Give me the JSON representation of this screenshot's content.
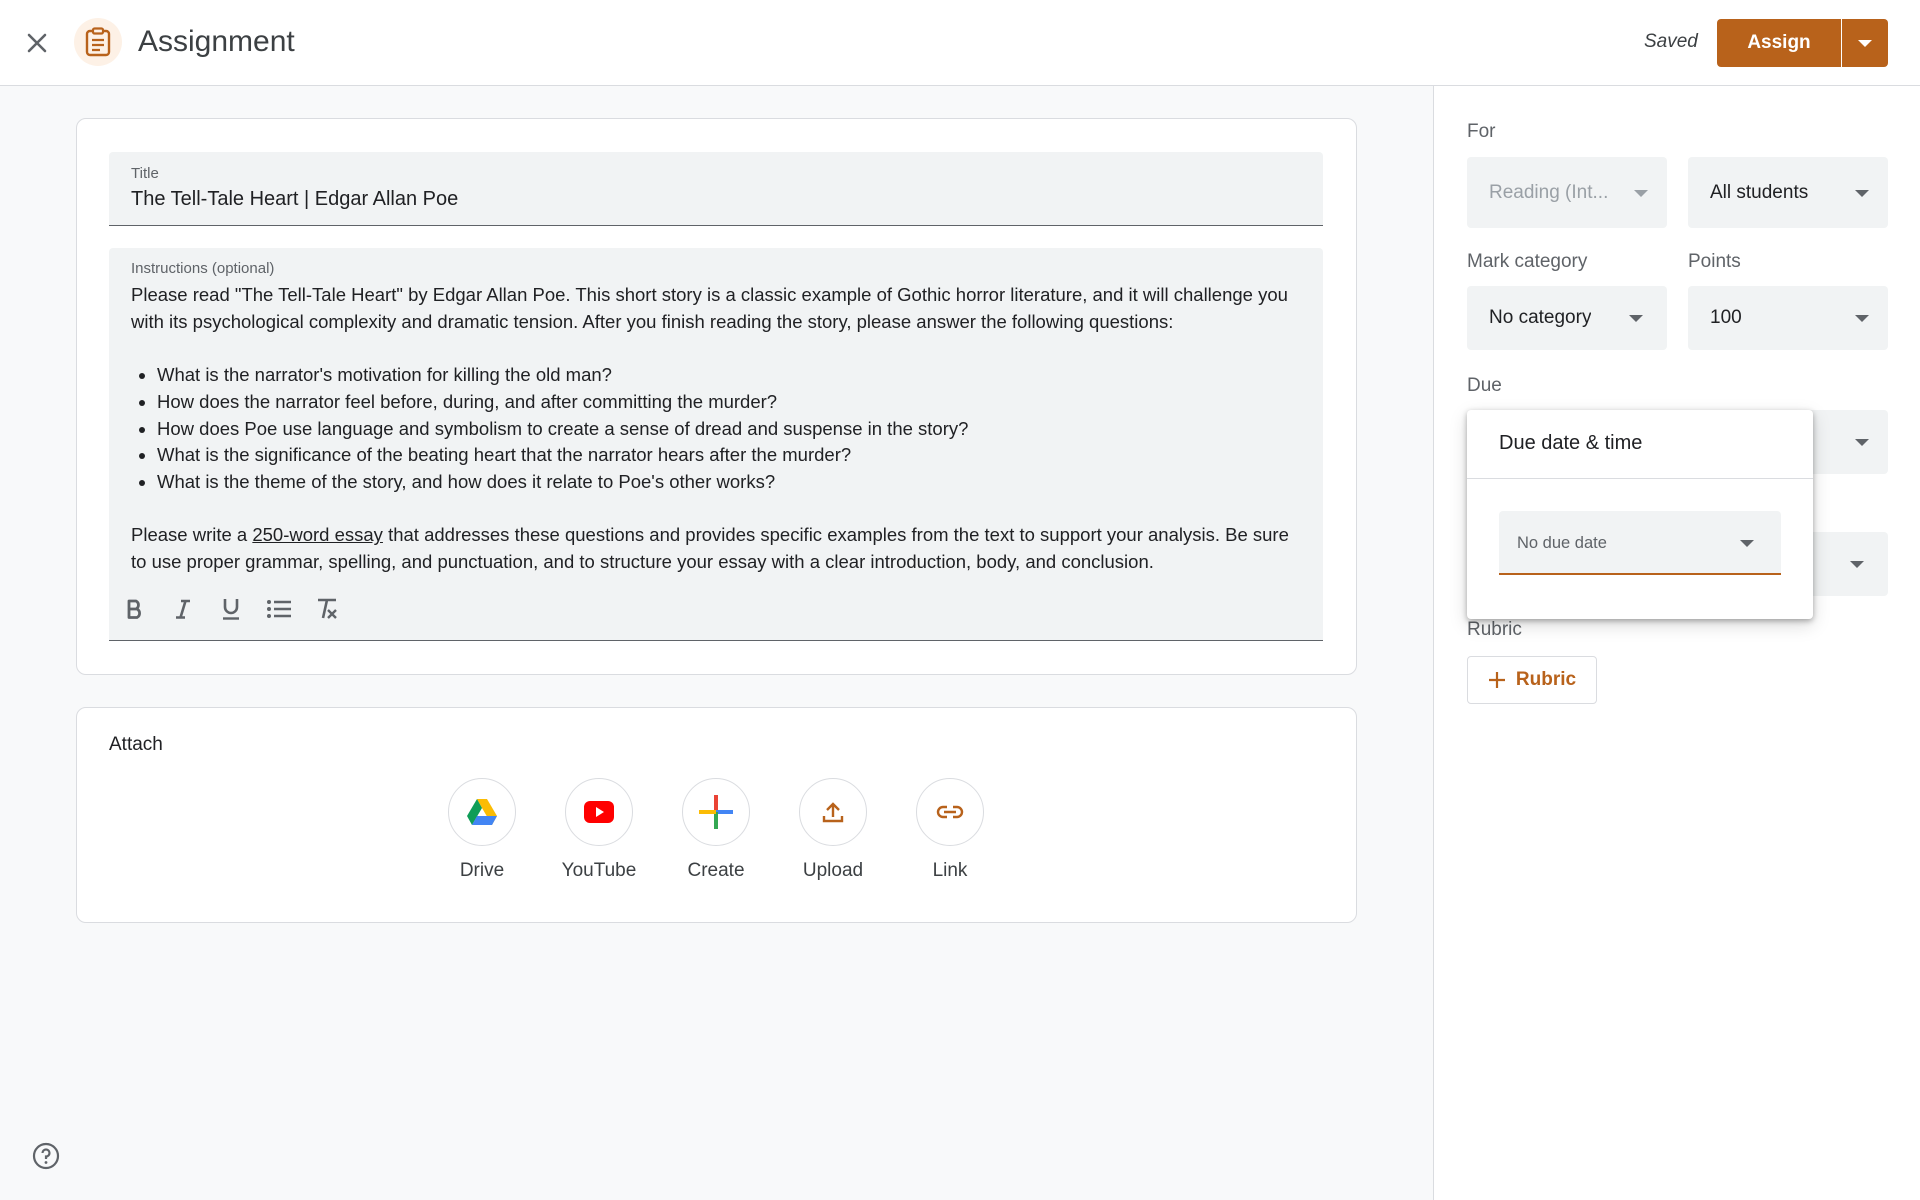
{
  "header": {
    "title": "Assignment",
    "status": "Saved",
    "assign_label": "Assign"
  },
  "main": {
    "title_label": "Title",
    "title_value": "The Tell-Tale Heart | Edgar Allan Poe",
    "instructions_label": "Instructions (optional)",
    "intro": "Please read \"The Tell-Tale Heart\" by Edgar Allan Poe. This short story is a classic example of Gothic horror literature, and it will challenge you with its psychological complexity and dramatic tension. After you finish reading the story, please answer the following questions:",
    "questions": [
      "What is the narrator's motivation for killing the old man?",
      "How does the narrator feel before, during, and after committing the murder?",
      "How does Poe use language and symbolism to create a sense of dread and suspense in the story?",
      "What is the significance of the beating heart that the narrator hears after the murder?",
      "What is the theme of the story, and how does it relate to Poe's other works?"
    ],
    "closing_before": "Please write a ",
    "closing_link": "250-word essay",
    "closing_after": " that addresses these questions and provides specific examples from the text to support your analysis. Be sure to use proper grammar, spelling, and punctuation, and to structure your essay with a clear introduction, body, and conclusion."
  },
  "attach": {
    "label": "Attach",
    "items": [
      {
        "label": "Drive",
        "icon": "drive-icon"
      },
      {
        "label": "YouTube",
        "icon": "youtube-icon"
      },
      {
        "label": "Create",
        "icon": "create-icon"
      },
      {
        "label": "Upload",
        "icon": "upload-icon"
      },
      {
        "label": "Link",
        "icon": "link-icon"
      }
    ]
  },
  "right": {
    "for_label": "For",
    "class_value": "Reading (Int...",
    "students_value": "All students",
    "category_label": "Mark category",
    "category_value": "No category",
    "points_label": "Points",
    "points_value": "100",
    "due_label": "Due",
    "rubric_label": "Rubric",
    "rubric_button": "Rubric"
  },
  "popover": {
    "title": "Due date & time",
    "select_value": "No due date"
  },
  "colors": {
    "accent": "#b8621b",
    "accent_light": "#fdf1e6"
  }
}
